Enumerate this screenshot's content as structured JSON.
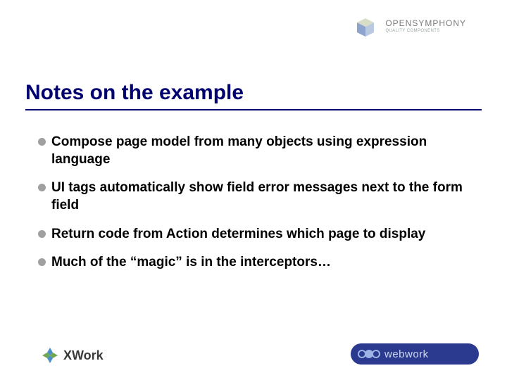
{
  "header": {
    "brand_name": "OPENSYMPHONY",
    "brand_tagline": "QUALITY COMPONENTS"
  },
  "title": "Notes on the example",
  "bullets": [
    "Compose page model from many objects using expression language",
    "UI tags automatically show field error messages next to the form field",
    "Return code from Action determines which page to display",
    "Much of the “magic” is in the interceptors…"
  ],
  "footer": {
    "xwork_label": "XWork",
    "webwork_label": "webwork"
  }
}
